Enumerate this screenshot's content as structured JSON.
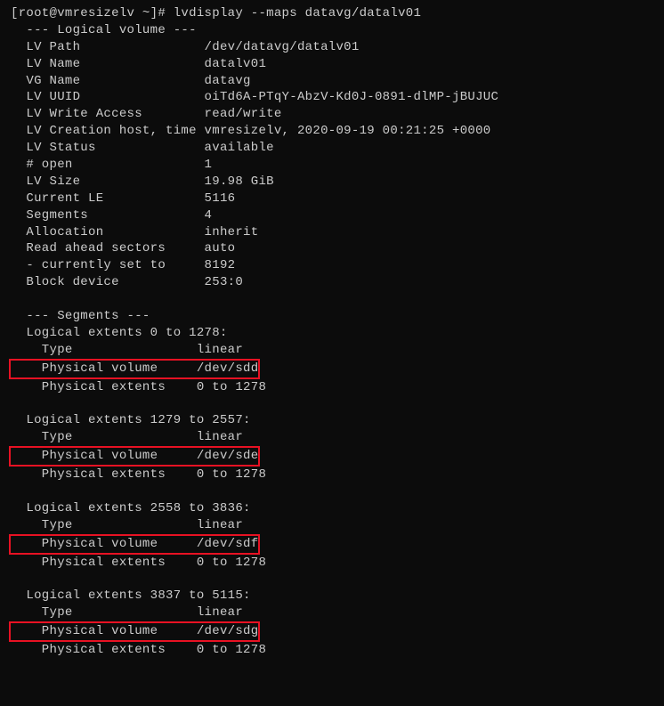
{
  "prompt": "[root@vmresizelv ~]# ",
  "command": "lvdisplay --maps datavg/datalv01",
  "lv_header": "  --- Logical volume ---",
  "lv_rows": [
    {
      "l": "  LV Path                ",
      "v": "/dev/datavg/datalv01"
    },
    {
      "l": "  LV Name                ",
      "v": "datalv01"
    },
    {
      "l": "  VG Name                ",
      "v": "datavg"
    },
    {
      "l": "  LV UUID                ",
      "v": "oiTd6A-PTqY-AbzV-Kd0J-0891-dlMP-jBUJUC"
    },
    {
      "l": "  LV Write Access        ",
      "v": "read/write"
    },
    {
      "l": "  LV Creation host, time ",
      "v": "vmresizelv, 2020-09-19 00:21:25 +0000"
    },
    {
      "l": "  LV Status              ",
      "v": "available"
    },
    {
      "l": "  # open                 ",
      "v": "1"
    },
    {
      "l": "  LV Size                ",
      "v": "19.98 GiB"
    },
    {
      "l": "  Current LE             ",
      "v": "5116"
    },
    {
      "l": "  Segments               ",
      "v": "4"
    },
    {
      "l": "  Allocation             ",
      "v": "inherit"
    },
    {
      "l": "  Read ahead sectors     ",
      "v": "auto"
    },
    {
      "l": "  - currently set to     ",
      "v": "8192"
    },
    {
      "l": "  Block device           ",
      "v": "253:0"
    }
  ],
  "seg_header": "  --- Segments ---",
  "segments": [
    {
      "range": "  Logical extents 0 to 1278:",
      "type_l": "    Type                ",
      "type_v": "linear",
      "pv_l": "    Physical volume     ",
      "pv_v": "/dev/sdd",
      "pe_l": "    Physical extents    ",
      "pe_v": "0 to 1278"
    },
    {
      "range": "  Logical extents 1279 to 2557:",
      "type_l": "    Type                ",
      "type_v": "linear",
      "pv_l": "    Physical volume     ",
      "pv_v": "/dev/sde",
      "pe_l": "    Physical extents    ",
      "pe_v": "0 to 1278"
    },
    {
      "range": "  Logical extents 2558 to 3836:",
      "type_l": "    Type                ",
      "type_v": "linear",
      "pv_l": "    Physical volume     ",
      "pv_v": "/dev/sdf",
      "pe_l": "    Physical extents    ",
      "pe_v": "0 to 1278"
    },
    {
      "range": "  Logical extents 3837 to 5115:",
      "type_l": "    Type                ",
      "type_v": "linear",
      "pv_l": "    Physical volume     ",
      "pv_v": "/dev/sdg",
      "pe_l": "    Physical extents    ",
      "pe_v": "0 to 1278"
    }
  ]
}
